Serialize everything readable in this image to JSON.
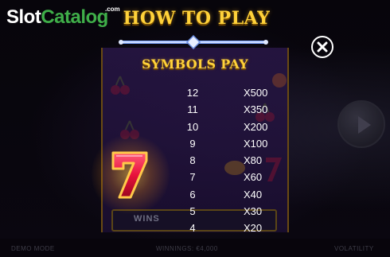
{
  "watermark": {
    "slot": "Slot",
    "catalog": "Catalog",
    "com": ".com"
  },
  "header": {
    "title": "HOW TO PLAY"
  },
  "close_icon": "close-icon",
  "section": {
    "title": "SYMBOLS PAY"
  },
  "symbol": {
    "name": "red-seven-symbol",
    "color": "#e8123c"
  },
  "paytable": [
    {
      "count": "12",
      "multiplier": "X500"
    },
    {
      "count": "11",
      "multiplier": "X350"
    },
    {
      "count": "10",
      "multiplier": "X200"
    },
    {
      "count": "9",
      "multiplier": "X100"
    },
    {
      "count": "8",
      "multiplier": "X80"
    },
    {
      "count": "7",
      "multiplier": "X60"
    },
    {
      "count": "6",
      "multiplier": "X40"
    },
    {
      "count": "5",
      "multiplier": "X30"
    },
    {
      "count": "4",
      "multiplier": "X20"
    }
  ],
  "background": {
    "wins_label": "WINS",
    "center_text": "WINNINGS: €4,000",
    "left_text": "DEMO MODE",
    "right_text": "VOLATILITY"
  },
  "colors": {
    "accent_gold": "#ffd23a",
    "brand_green": "#3fae49",
    "panel_purple": "#2a1648"
  }
}
